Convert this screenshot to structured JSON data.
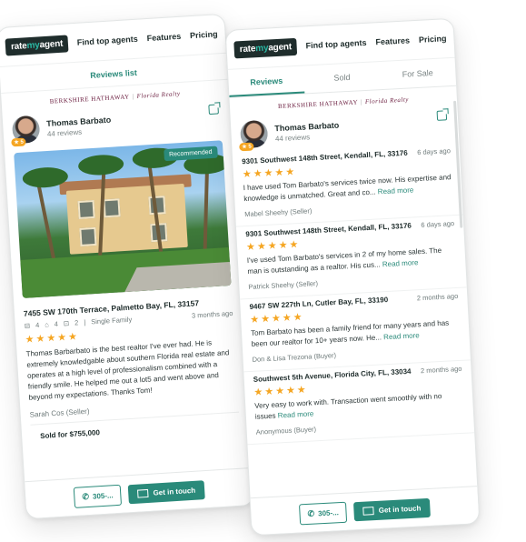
{
  "nav": {
    "logo_text": "ratemyagent",
    "links": [
      "Find top agents",
      "Features",
      "Pricing"
    ]
  },
  "left": {
    "subheader": "Reviews list",
    "brand": {
      "name": "BERKSHIRE HATHAWAY",
      "sep": "|",
      "location": "Florida Realty"
    },
    "agent": {
      "name": "Thomas Barbato",
      "reviews": "44 reviews",
      "rating": "5"
    },
    "recommended": "Recommended",
    "address": "7455 SW 170th Terrace, Palmetto Bay, FL, 33157",
    "specs": {
      "beds": "4",
      "baths": "4",
      "cars": "2",
      "type": "Single Family",
      "time": "3 months ago"
    },
    "stars": "★★★★★",
    "review": "Thomas Barbarbato is the best realtor I've ever had. He is extremely knowledgable about southern Florida real estate and operates at a high level of professionalism combined with a friendly smile. He helped me out a lot5 and went above and beyond my expectations. Thanks Tom!",
    "reviewer": "Sarah Cos (Seller)",
    "sold": "Sold for $755,000"
  },
  "right": {
    "tabs": [
      "Reviews",
      "Sold",
      "For Sale"
    ],
    "brand": {
      "name": "BERKSHIRE HATHAWAY",
      "sep": "|",
      "location": "Florida Realty"
    },
    "agent": {
      "name": "Thomas Barbato",
      "reviews": "44 reviews",
      "rating": "5"
    },
    "reviews": [
      {
        "address": "9301 Southwest 148th Street, Kendall, FL, 33176",
        "time": "6 days ago",
        "stars": "★★★★★",
        "text": "I have used Tom Barbato's services twice now. His expertise and knowledge is unmatched. Great and co...",
        "more": "Read more",
        "author": "Mabel Sheehy (Seller)"
      },
      {
        "address": "9301 Southwest 148th Street, Kendall, FL, 33176",
        "time": "6 days ago",
        "stars": "★★★★★",
        "text": "I've used Tom Barbato's services in 2 of my home sales. The man is outstanding as a realtor. His cus...",
        "more": "Read more",
        "author": "Patrick Sheehy (Seller)"
      },
      {
        "address": "9467 SW 227th Ln, Cutler Bay, FL, 33190",
        "time": "2 months ago",
        "stars": "★★★★★",
        "text": "Tom Barbato has been a family friend for many years and has been our realtor for 10+ years now. He...",
        "more": "Read more",
        "author": "Don & Lisa Trezona (Buyer)"
      },
      {
        "address": "Southwest 5th Avenue, Florida City, FL, 33034",
        "time": "2 months ago",
        "stars": "★★★★★",
        "text": "Very easy to work with. Transaction went smoothly with no issues",
        "more": "Read more",
        "author": "Anonymous (Buyer)"
      }
    ]
  },
  "footer": {
    "phone": "305-...",
    "contact": "Get in touch"
  }
}
